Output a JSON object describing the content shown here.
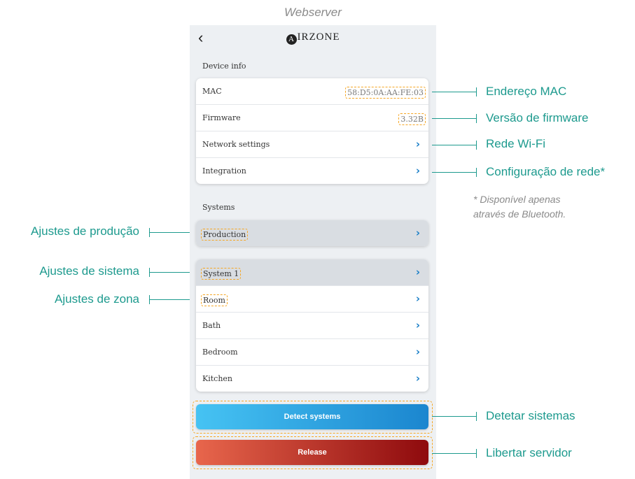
{
  "caption": "Webserver",
  "header": {
    "logo_letter": "A",
    "logo_text": "IRZONE"
  },
  "device_info": {
    "title": "Device info",
    "mac_label": "MAC",
    "mac_value": "58:D5:0A:AA:FE:03",
    "firmware_label": "Firmware",
    "firmware_value": "3.32B",
    "network_label": "Network settings",
    "integration_label": "Integration"
  },
  "systems": {
    "title": "Systems",
    "production": "Production",
    "items": [
      "System 1",
      "Room",
      "Bath",
      "Bedroom",
      "Kitchen"
    ]
  },
  "buttons": {
    "detect": "Detect systems",
    "release": "Release"
  },
  "annotations": {
    "mac": "Endereço MAC",
    "firmware": "Versão de firmware",
    "wifi": "Rede Wi-Fi",
    "network": "Configuração de rede*",
    "note_line1": "* Disponível apenas",
    "note_line2": "através de Bluetooth.",
    "production": "Ajustes de produção",
    "system": "Ajustes de sistema",
    "zone": "Ajustes de zona",
    "detect": "Detetar sistemas",
    "release": "Libertar servidor"
  },
  "colors": {
    "annotation": "#1d9a8e",
    "highlight": "#f5a623",
    "chevron": "#1a7fc8",
    "detect_gradient": [
      "#46c3f3",
      "#1b86cf"
    ],
    "release_gradient": [
      "#e8664c",
      "#8e0a0d"
    ]
  }
}
